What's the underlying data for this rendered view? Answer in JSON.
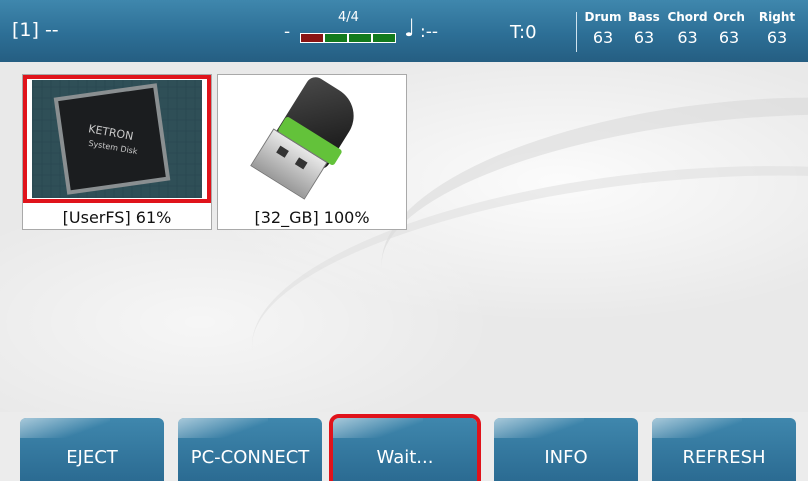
{
  "topbar": {
    "slot": "[1] --",
    "dash": "-",
    "time_signature": "4/4",
    "beats": 4,
    "tempo_icon": "quarter-note-icon",
    "tempo_glyph": "♩",
    "tempo_value": ":--",
    "transpose": "T:0",
    "channels": [
      {
        "name": "Drum",
        "value": "63"
      },
      {
        "name": "Bass",
        "value": "63"
      },
      {
        "name": "Chord",
        "value": "63"
      },
      {
        "name": "Orch",
        "value": "63"
      },
      {
        "name": "Right",
        "value": "63"
      }
    ]
  },
  "drives": [
    {
      "label": "[UserFS] 61%",
      "image": "ketron-system-disk-chip",
      "selected": true,
      "chip_brand": "KETRON",
      "chip_text": "System Disk"
    },
    {
      "label": "[32_GB] 100%",
      "image": "usb-flash-drive",
      "selected": false
    }
  ],
  "buttons": [
    {
      "label": "EJECT",
      "highlighted": false
    },
    {
      "label": "PC-CONNECT",
      "highlighted": false
    },
    {
      "label": "Wait...",
      "highlighted": true
    },
    {
      "label": "INFO",
      "highlighted": false
    },
    {
      "label": "REFRESH",
      "highlighted": false
    }
  ],
  "colors": {
    "bar_blue": "#2d6f96",
    "highlight_red": "#e0131b",
    "beat_first": "#8a1414",
    "beat_other": "#137a1d"
  }
}
